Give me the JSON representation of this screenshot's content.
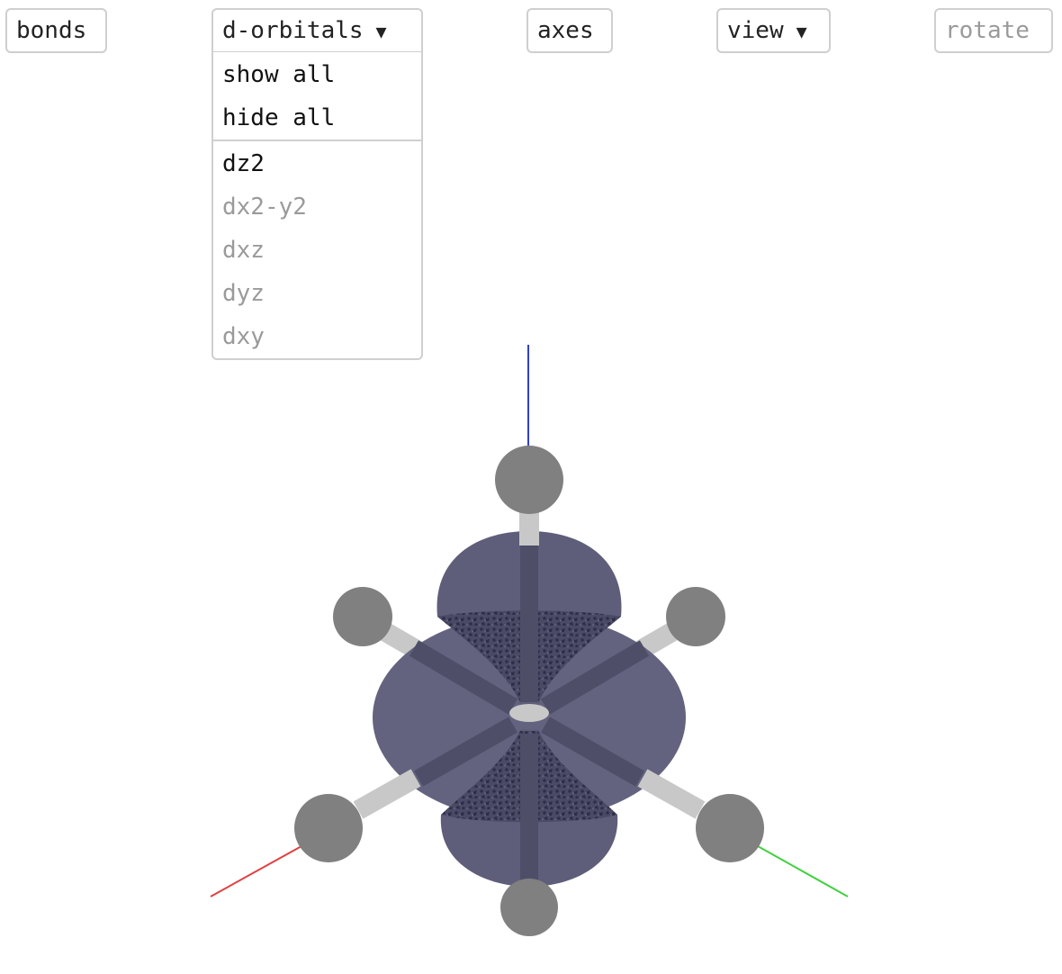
{
  "toolbar": {
    "bonds_label": "bonds",
    "orbitals_label": "d-orbitals",
    "axes_label": "axes",
    "view_label": "view",
    "rotate_label": "rotate",
    "dropdown_caret": "▼"
  },
  "orbital_menu": {
    "show_all": "show all",
    "hide_all": "hide all",
    "items": [
      {
        "label": "dz2",
        "enabled": true
      },
      {
        "label": "dx2-y2",
        "enabled": false
      },
      {
        "label": "dxz",
        "enabled": false
      },
      {
        "label": "dyz",
        "enabled": false
      },
      {
        "label": "dxy",
        "enabled": false
      }
    ]
  },
  "viewer": {
    "colors": {
      "x_axis": "#e04040",
      "y_axis": "#40d040",
      "z_axis": "#3040d0",
      "atom": "#808080",
      "bond": "#c8c8c8",
      "orbital_lobe": "#5e5e7a",
      "orbital_torus": "#63637f",
      "orbital_texture": "#3a3a55"
    },
    "active_orbital": "dz2"
  }
}
